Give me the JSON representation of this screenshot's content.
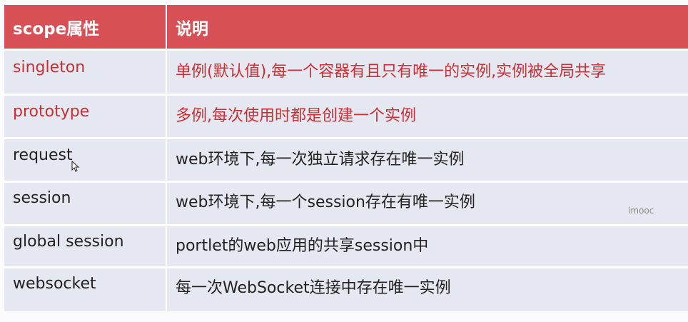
{
  "table": {
    "headers": [
      "scope属性",
      "说明"
    ],
    "rows": [
      {
        "scope": "singleton",
        "desc": "单例(默认值),每一个容器有且只有唯一的实例,实例被全局共享"
      },
      {
        "scope": "prototype",
        "desc": "多例,每次使用时都是创建一个实例"
      },
      {
        "scope": "request",
        "desc": "web环境下,每一次独立请求存在唯一实例"
      },
      {
        "scope": "session",
        "desc": "web环境下,每一个session存在有唯一实例"
      },
      {
        "scope": "global session",
        "desc": "portlet的web应用的共享session中"
      },
      {
        "scope": "websocket",
        "desc": "每一次WebSocket连接中存在唯一实例"
      }
    ]
  },
  "watermark": "imooc",
  "colors": {
    "header_bg": "#d65056",
    "row_bg": "#e5e8f1",
    "highlight_text": "#c83036"
  }
}
